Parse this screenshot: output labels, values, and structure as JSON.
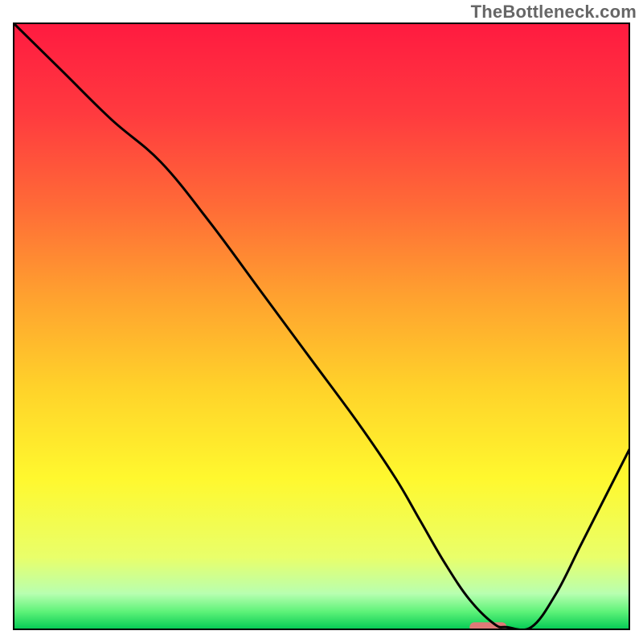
{
  "watermark": "TheBottleneck.com",
  "chart_data": {
    "type": "line",
    "title": "",
    "xlabel": "",
    "ylabel": "",
    "xlim": [
      0,
      100
    ],
    "ylim": [
      0,
      100
    ],
    "grid": false,
    "legend": null,
    "gradient_stops": [
      {
        "offset": 0.0,
        "color": "#ff1a40"
      },
      {
        "offset": 0.15,
        "color": "#ff3a3f"
      },
      {
        "offset": 0.3,
        "color": "#ff6a37"
      },
      {
        "offset": 0.45,
        "color": "#ffa12f"
      },
      {
        "offset": 0.6,
        "color": "#ffd22a"
      },
      {
        "offset": 0.75,
        "color": "#fff82e"
      },
      {
        "offset": 0.88,
        "color": "#e9ff6a"
      },
      {
        "offset": 0.94,
        "color": "#b8ffb0"
      },
      {
        "offset": 0.97,
        "color": "#5cf278"
      },
      {
        "offset": 1.0,
        "color": "#00c853"
      }
    ],
    "series": [
      {
        "name": "bottleneck-curve",
        "color": "#000000",
        "x": [
          0,
          8,
          16,
          24,
          32,
          40,
          48,
          56,
          62,
          66,
          70,
          74,
          78,
          80,
          84,
          88,
          92,
          96,
          100
        ],
        "y": [
          100,
          92,
          84,
          77,
          67,
          56,
          45,
          34,
          25,
          18,
          11,
          5,
          1,
          0.5,
          0.5,
          6,
          14,
          22,
          30
        ]
      }
    ],
    "marker": {
      "x_start": 74,
      "x_end": 80,
      "y": 0.5,
      "color": "#e07a78"
    }
  }
}
